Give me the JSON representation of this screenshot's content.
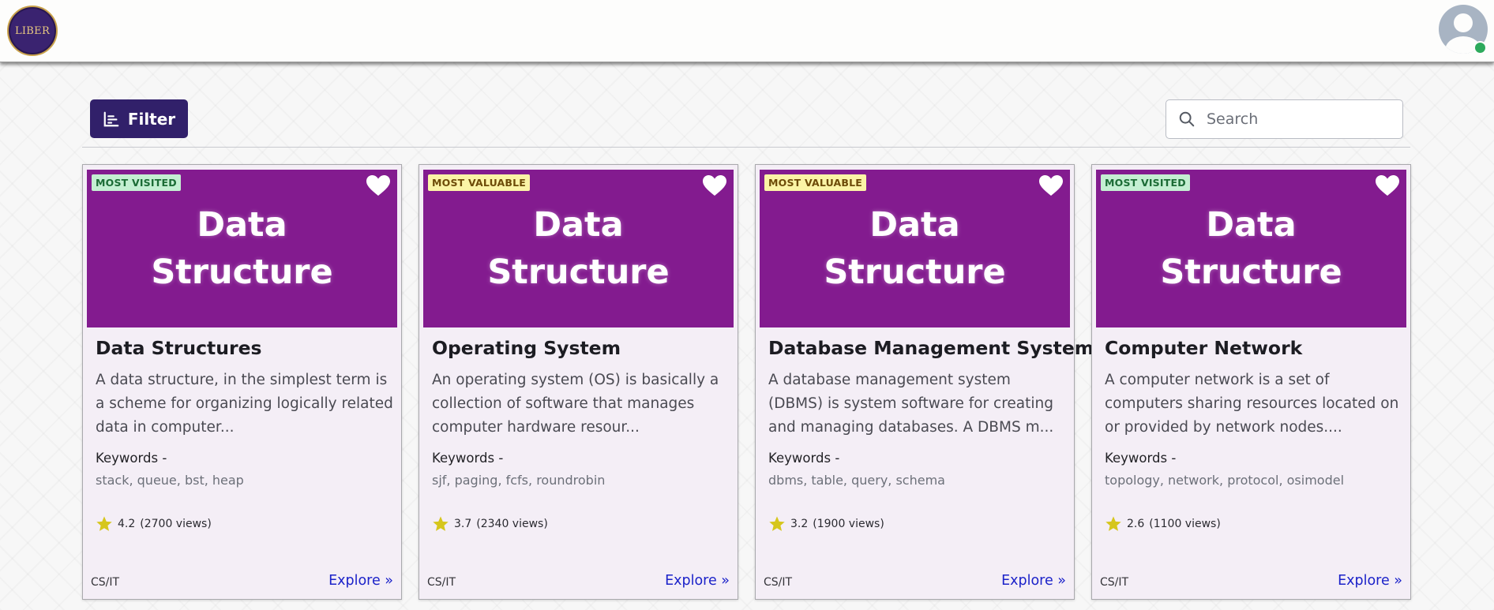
{
  "navbar": {
    "logo_text": "LIBER",
    "avatar_icon": "user-avatar-icon",
    "status_color": "#2daa5c"
  },
  "toolbar": {
    "filter_label": "Filter",
    "filter_icon": "bar-chart-icon",
    "search_placeholder": "Search",
    "search_value": "",
    "search_icon": "search-icon"
  },
  "colors": {
    "primary": "#31206a",
    "card_thumb": "#831b8f",
    "card_bg": "#f4eef6",
    "link": "#1b22c9",
    "star": "#d6c61c"
  },
  "cards": [
    {
      "badge": "MOST VISITED",
      "badge_type": "visited",
      "thumb_line1": "Data",
      "thumb_line2": "Structure",
      "title": "Data Structures",
      "description": "A data structure, in the simplest term is a scheme for organizing logically related data in computer...",
      "keywords_label": "Keywords -",
      "keywords": "stack, queue, bst, heap",
      "rating": "4.2",
      "views": "(2700 views)",
      "category": "CS/IT",
      "explore_label": "Explore »"
    },
    {
      "badge": "MOST VALUABLE",
      "badge_type": "valuable",
      "thumb_line1": "Data",
      "thumb_line2": "Structure",
      "title": "Operating System",
      "description": "An operating system (OS) is basically a collection of software that manages computer hardware resour...",
      "keywords_label": "Keywords -",
      "keywords": "sjf, paging, fcfs, roundrobin",
      "rating": "3.7",
      "views": "(2340 views)",
      "category": "CS/IT",
      "explore_label": "Explore »"
    },
    {
      "badge": "MOST VALUABLE",
      "badge_type": "valuable",
      "thumb_line1": "Data",
      "thumb_line2": "Structure",
      "title": "Database Management System",
      "description": "A database management system (DBMS) is system software for creating and managing databases. A DBMS m...",
      "keywords_label": "Keywords -",
      "keywords": "dbms, table, query, schema",
      "rating": "3.2",
      "views": "(1900 views)",
      "category": "CS/IT",
      "explore_label": "Explore »"
    },
    {
      "badge": "MOST VISITED",
      "badge_type": "visited",
      "thumb_line1": "Data",
      "thumb_line2": "Structure",
      "title": "Computer Network",
      "description": "A computer network is a set of computers sharing resources located on or provided by network nodes....",
      "keywords_label": "Keywords -",
      "keywords": "topology, network, protocol, osimodel",
      "rating": "2.6",
      "views": "(1100 views)",
      "category": "CS/IT",
      "explore_label": "Explore »"
    }
  ]
}
